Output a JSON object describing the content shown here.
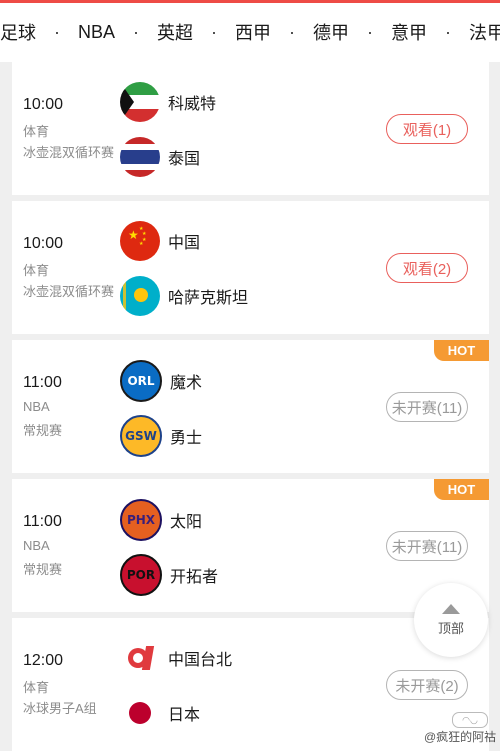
{
  "tabs": [
    "足球",
    "NBA",
    "英超",
    "西甲",
    "德甲",
    "意甲",
    "法甲"
  ],
  "tab_separator": "·",
  "matches": [
    {
      "time": "10:00",
      "category": "体育",
      "league": "冰壶混双循环赛",
      "home": {
        "name": "科威特",
        "icon": "kuwait-flag-icon"
      },
      "away": {
        "name": "泰国",
        "icon": "thailand-flag-icon"
      },
      "button": "观看(1)",
      "hot": ""
    },
    {
      "time": "10:00",
      "category": "体育",
      "league": "冰壶混双循环赛",
      "home": {
        "name": "中国",
        "icon": "china-flag-icon"
      },
      "away": {
        "name": "哈萨克斯坦",
        "icon": "kazakhstan-flag-icon"
      },
      "button": "观看(2)",
      "hot": ""
    },
    {
      "time": "11:00",
      "category": "NBA",
      "league": "常规赛",
      "home": {
        "name": "魔术",
        "logo": "ORL",
        "icon": "magic-logo-icon"
      },
      "away": {
        "name": "勇士",
        "logo": "GSW",
        "icon": "warriors-logo-icon"
      },
      "button": "未开赛(11)",
      "hot": "HOT"
    },
    {
      "time": "11:00",
      "category": "NBA",
      "league": "常规赛",
      "home": {
        "name": "太阳",
        "logo": "PHX",
        "icon": "suns-logo-icon"
      },
      "away": {
        "name": "开拓者",
        "logo": "POR",
        "icon": "blazers-logo-icon"
      },
      "button": "未开赛(11)",
      "hot": "HOT"
    },
    {
      "time": "12:00",
      "category": "体育",
      "league": "冰球男子A组",
      "home": {
        "name": "中国台北",
        "icon": "chinese-taipei-flag-icon"
      },
      "away": {
        "name": "日本",
        "icon": "japan-flag-icon"
      },
      "button": "未开赛(2)",
      "hot": ""
    }
  ],
  "back_to_top": "顶部",
  "watermark": "@疯狂的阿祜",
  "colors": {
    "accent": "#ee4b46",
    "hot": "#f59a33",
    "watch_border": "#e9605c",
    "wait_border": "#b4b4b4"
  }
}
